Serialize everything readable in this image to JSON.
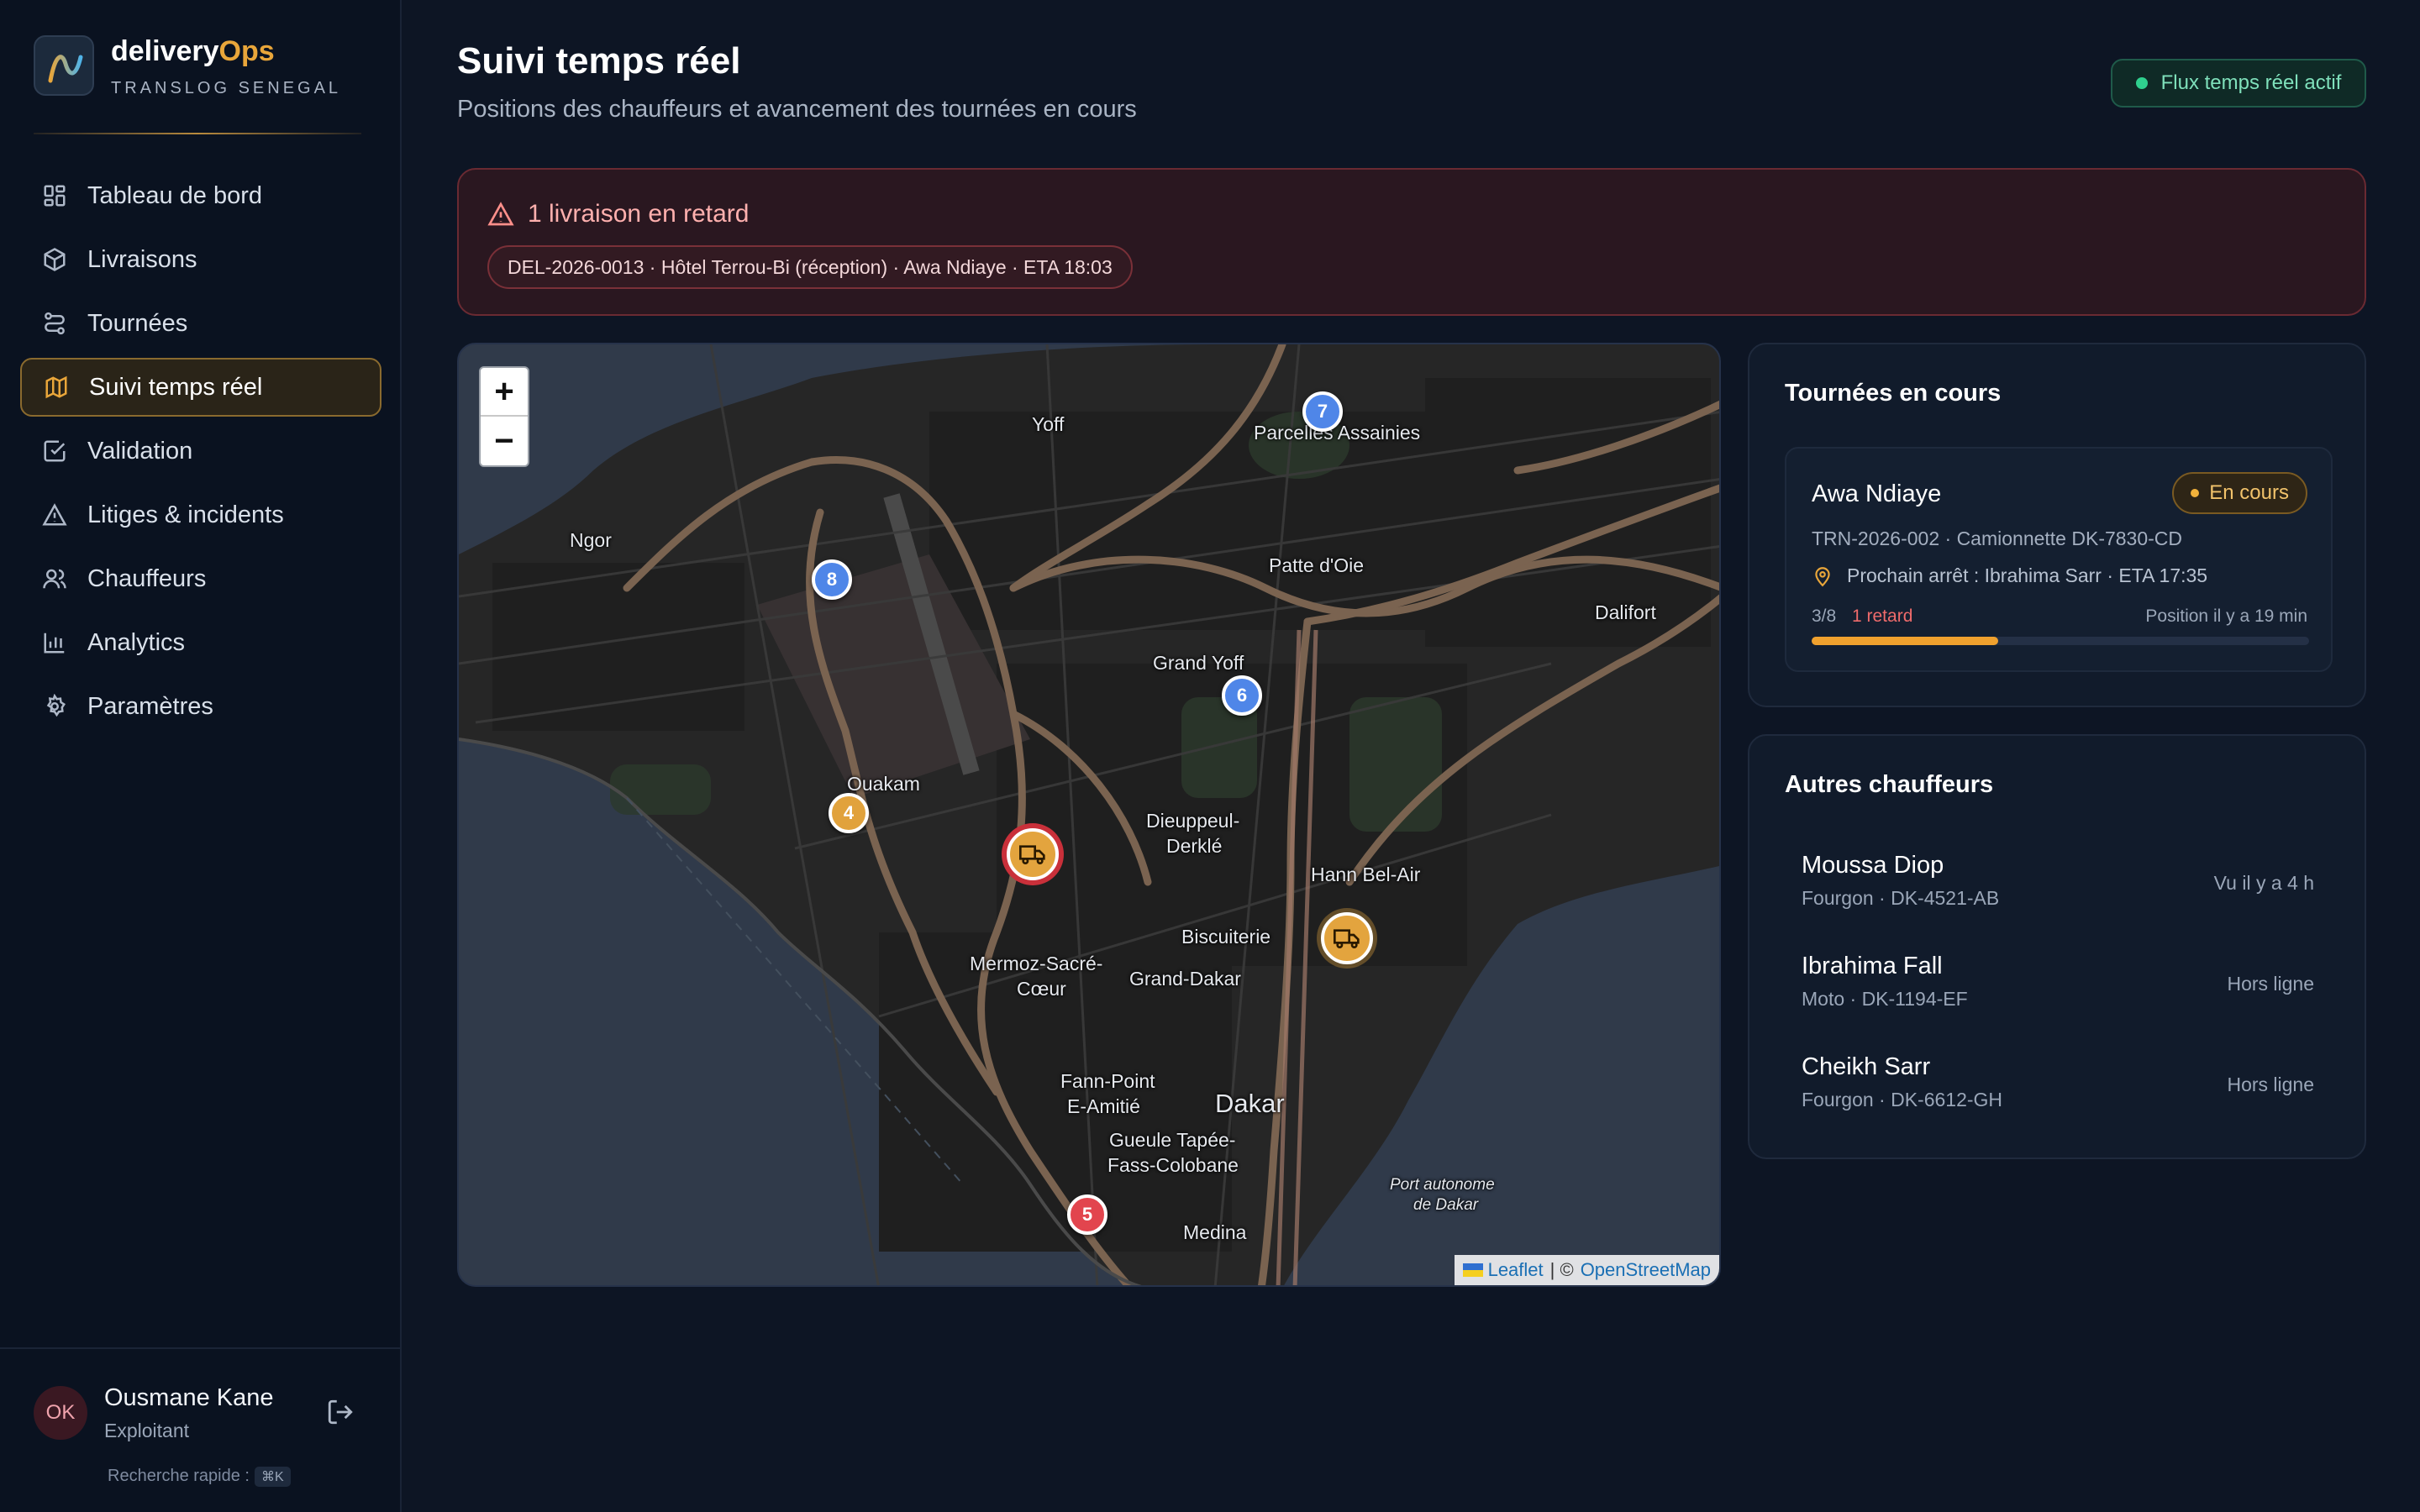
{
  "app": {
    "brand_part1": "delivery",
    "brand_part2": "Ops",
    "company": "TRANSLOG SENEGAL"
  },
  "nav": {
    "items": [
      {
        "label": "Tableau de bord",
        "icon": "dashboard-icon"
      },
      {
        "label": "Livraisons",
        "icon": "package-icon"
      },
      {
        "label": "Tournées",
        "icon": "route-icon"
      },
      {
        "label": "Suivi temps réel",
        "icon": "map-icon",
        "active": true
      },
      {
        "label": "Validation",
        "icon": "check-square-icon"
      },
      {
        "label": "Litiges & incidents",
        "icon": "warning-icon"
      },
      {
        "label": "Chauffeurs",
        "icon": "users-icon"
      },
      {
        "label": "Analytics",
        "icon": "bar-chart-icon"
      },
      {
        "label": "Paramètres",
        "icon": "gear-icon"
      }
    ]
  },
  "user": {
    "initials": "OK",
    "name": "Ousmane Kane",
    "role": "Exploitant",
    "quick_search": "Recherche rapide :",
    "shortcut": "⌘K"
  },
  "header": {
    "title": "Suivi temps réel",
    "subtitle": "Positions des chauffeurs et avancement des tournées en cours",
    "live_status": "Flux temps réel actif"
  },
  "alert": {
    "title": "1 livraison en retard",
    "item": "DEL-2026-0013 · Hôtel Terrou-Bi (réception) · Awa Ndiaye · ETA 18:03"
  },
  "map": {
    "zoom_in": "+",
    "zoom_out": "−",
    "labels": {
      "yoff": "Yoff",
      "parcelles": "Parcelles Assainies",
      "ngor": "Ngor",
      "patte_doie": "Patte d'Oie",
      "dalifort": "Dalifort",
      "grand_yoff": "Grand Yoff",
      "ouakam": "Ouakam",
      "dieuppeul_1": "Dieuppeul-",
      "dieuppeul_2": "Derklé",
      "hann": "Hann Bel-Air",
      "biscuiterie": "Biscuiterie",
      "mermoz_1": "Mermoz-Sacré-",
      "mermoz_2": "Cœur",
      "grand_dakar": "Grand-Dakar",
      "fann_1": "Fann-Point",
      "fann_2": "E-Amitié",
      "dakar": "Dakar",
      "gueule_1": "Gueule Tapée-",
      "gueule_2": "Fass-Colobane",
      "medina": "Medina",
      "port_1": "Port autonome",
      "port_2": "de Dakar"
    },
    "markers": [
      {
        "label": "7",
        "color": "blue"
      },
      {
        "label": "8",
        "color": "blue"
      },
      {
        "label": "6",
        "color": "blue"
      },
      {
        "label": "4",
        "color": "orange"
      },
      {
        "label": "5",
        "color": "red"
      }
    ],
    "attribution": {
      "leaflet": "Leaflet",
      "separator": "| ©",
      "osm": "OpenStreetMap"
    }
  },
  "tours": {
    "title": "Tournées en cours",
    "card": {
      "driver": "Awa Ndiaye",
      "status": "En cours",
      "details": "TRN-2026-002 · Camionnette DK-7830-CD",
      "next_stop": "Prochain arrêt : Ibrahima Sarr · ETA 17:35",
      "count": "3/8",
      "late": "1 retard",
      "position": "Position il y a 19 min",
      "progress": 0.375
    }
  },
  "others": {
    "title": "Autres chauffeurs",
    "drivers": [
      {
        "name": "Moussa Diop",
        "vehicle": "Fourgon · DK-4521-AB",
        "status": "Vu il y a 4 h"
      },
      {
        "name": "Ibrahima Fall",
        "vehicle": "Moto · DK-1194-EF",
        "status": "Hors ligne"
      },
      {
        "name": "Cheikh Sarr",
        "vehicle": "Fourgon · DK-6612-GH",
        "status": "Hors ligne"
      }
    ]
  },
  "colors": {
    "accent": "#e9a63a",
    "live": "#2fd08e",
    "alert": "#ef6b6b",
    "marker_blue": "#4f86e8",
    "marker_red": "#e2454e"
  }
}
